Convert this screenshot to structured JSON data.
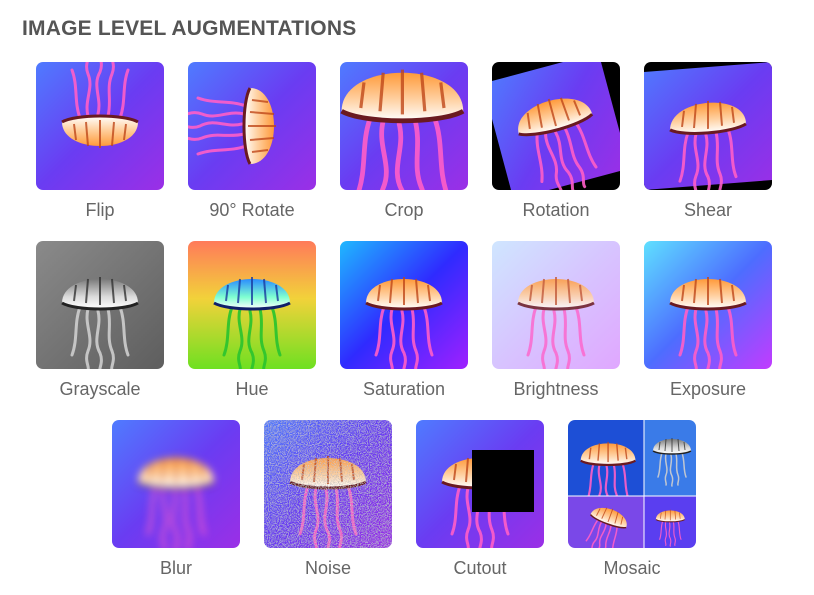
{
  "title": "IMAGE LEVEL AUGMENTATIONS",
  "colors": {
    "title_text": "#555555",
    "label_text": "#666666",
    "bg_blue": "#3a5cf0",
    "bg_purple": "#8a2be2",
    "jelly_pink": "#ff5fc8",
    "jelly_orange": "#ff8a2a",
    "cutout_black": "#000000"
  },
  "rows": [
    {
      "items": [
        {
          "label": "Flip",
          "icon": "jellyfish-flipped-image"
        },
        {
          "label": "90° Rotate",
          "icon": "jellyfish-rotated-90-image"
        },
        {
          "label": "Crop",
          "icon": "jellyfish-cropped-image"
        },
        {
          "label": "Rotation",
          "icon": "jellyfish-rotated-image"
        },
        {
          "label": "Shear",
          "icon": "jellyfish-sheared-image"
        }
      ]
    },
    {
      "items": [
        {
          "label": "Grayscale",
          "icon": "jellyfish-grayscale-image"
        },
        {
          "label": "Hue",
          "icon": "jellyfish-hue-shift-image"
        },
        {
          "label": "Saturation",
          "icon": "jellyfish-saturated-image"
        },
        {
          "label": "Brightness",
          "icon": "jellyfish-bright-image"
        },
        {
          "label": "Exposure",
          "icon": "jellyfish-exposure-image"
        }
      ]
    },
    {
      "items": [
        {
          "label": "Blur",
          "icon": "jellyfish-blurred-image"
        },
        {
          "label": "Noise",
          "icon": "jellyfish-noise-image"
        },
        {
          "label": "Cutout",
          "icon": "jellyfish-cutout-image"
        },
        {
          "label": "Mosaic",
          "icon": "jellyfish-mosaic-image"
        }
      ]
    }
  ]
}
